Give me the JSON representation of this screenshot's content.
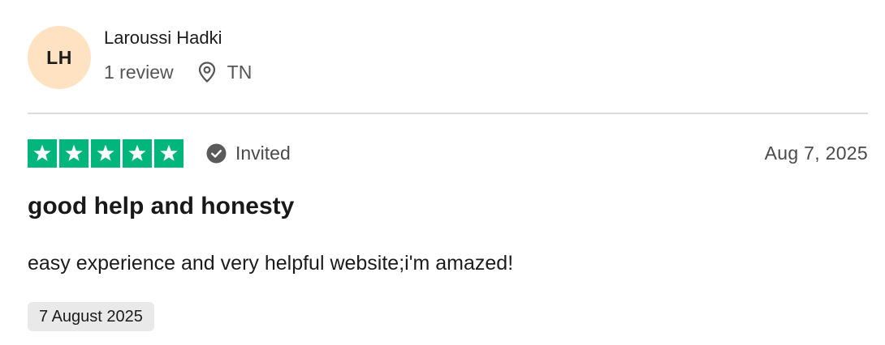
{
  "reviewer": {
    "initials": "LH",
    "name": "Laroussi Hadki",
    "review_count": "1 review",
    "country": "TN",
    "avatar_color": "#ffe2c2"
  },
  "review": {
    "rating": 5,
    "rating_max": 5,
    "star_color": "#00b67a",
    "status_label": "Invited",
    "date_short": "Aug 7, 2025",
    "title": "good help and honesty",
    "body": "easy experience and very helpful website;i'm amazed!",
    "experience_date": "7 August 2025"
  },
  "icons": {
    "location": "location-pin-icon",
    "verified": "check-circle-icon",
    "star": "star-icon"
  }
}
